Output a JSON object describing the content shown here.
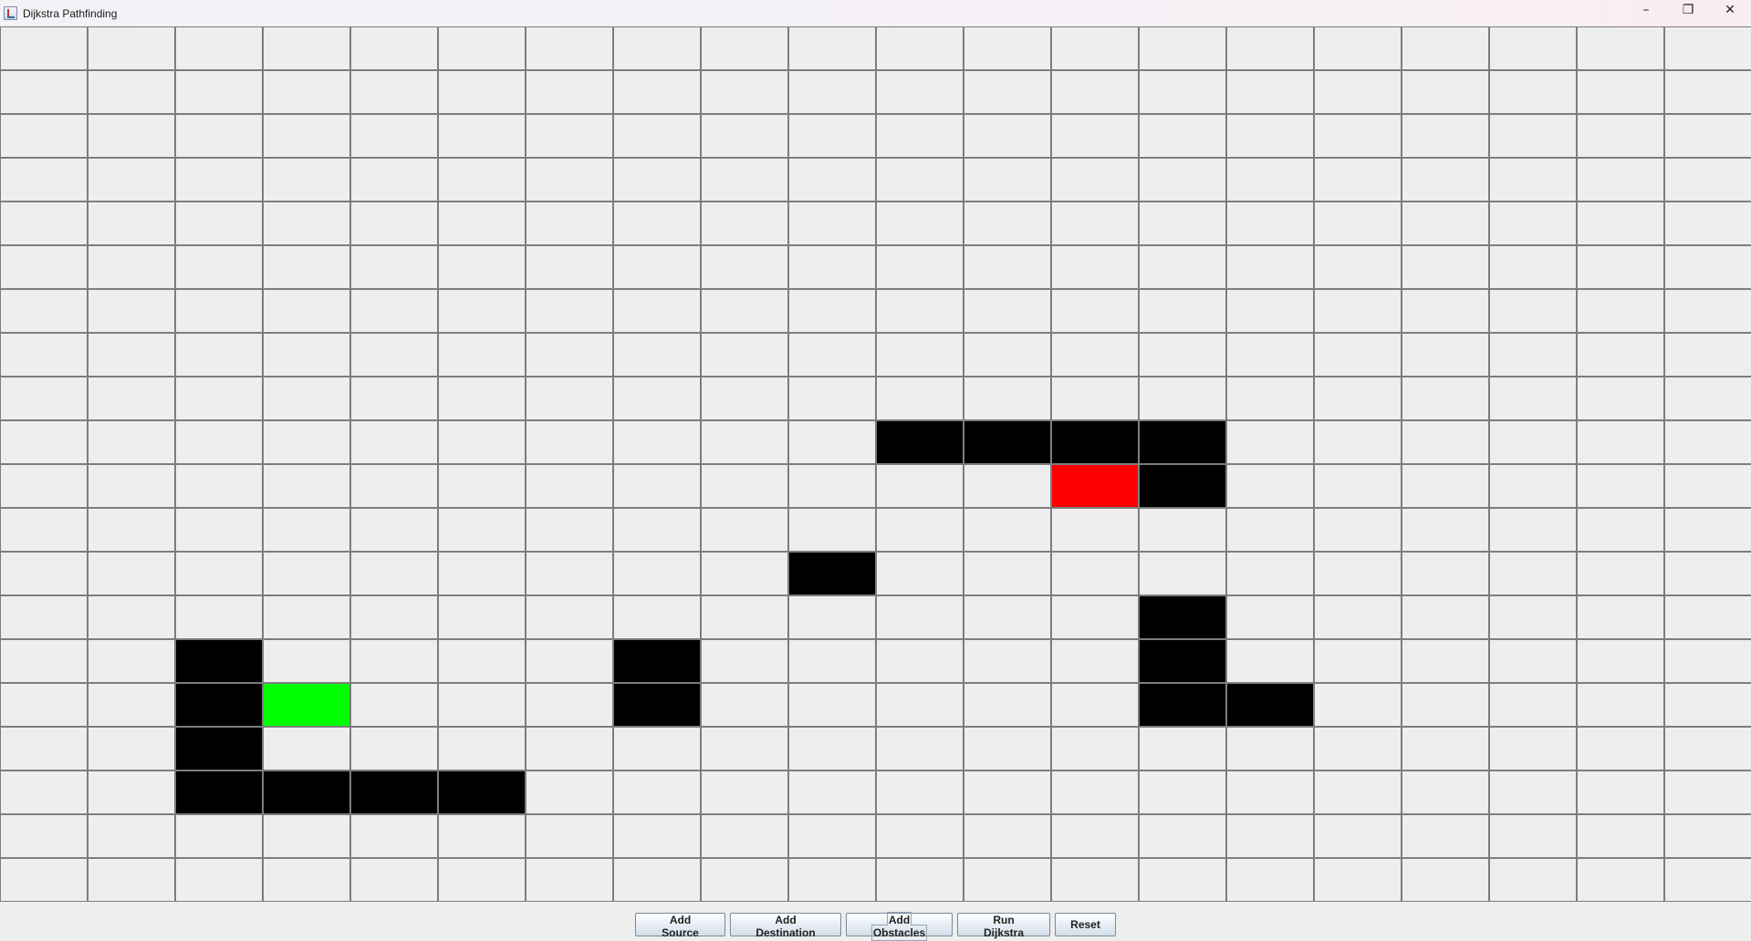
{
  "window": {
    "title": "Dijkstra Pathfinding",
    "icon": "java-cup-icon",
    "controls": {
      "minimize": "–",
      "maximize": "❐",
      "close": "✕"
    }
  },
  "grid": {
    "rows": 20,
    "cols": 20,
    "colors": {
      "empty": "#eeeeee",
      "obstacle": "#000000",
      "source": "#00ff00",
      "destination": "#ff0000",
      "gridline": "#7d7d7d"
    },
    "source": [
      15,
      3
    ],
    "destination": [
      10,
      12
    ],
    "obstacles": [
      [
        9,
        10
      ],
      [
        9,
        11
      ],
      [
        9,
        12
      ],
      [
        9,
        13
      ],
      [
        10,
        13
      ],
      [
        12,
        9
      ],
      [
        13,
        13
      ],
      [
        14,
        2
      ],
      [
        14,
        7
      ],
      [
        14,
        13
      ],
      [
        15,
        2
      ],
      [
        15,
        7
      ],
      [
        15,
        13
      ],
      [
        15,
        14
      ],
      [
        16,
        2
      ],
      [
        17,
        2
      ],
      [
        17,
        3
      ],
      [
        17,
        4
      ],
      [
        17,
        5
      ]
    ]
  },
  "toolbar": {
    "add_source": "Add Source",
    "add_destination": "Add Destination",
    "add_obstacles": "Add Obstacles",
    "run_dijkstra": "Run Dijkstra",
    "reset": "Reset"
  }
}
